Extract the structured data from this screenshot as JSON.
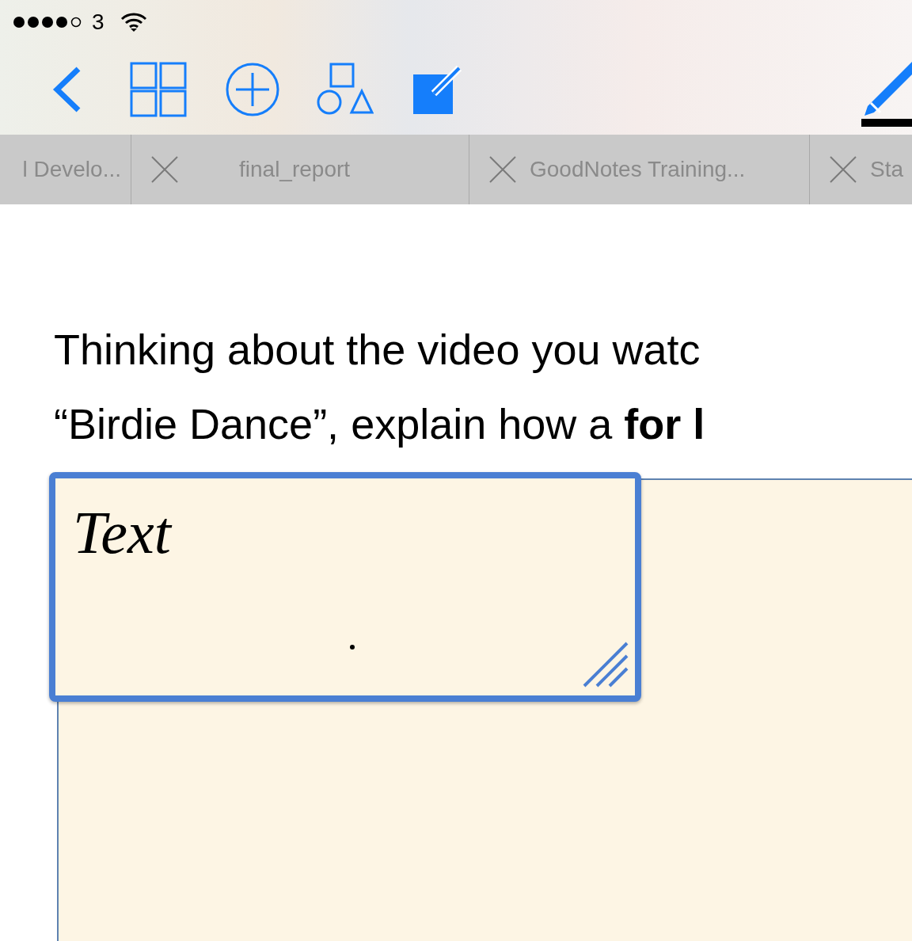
{
  "status_bar": {
    "carrier": "3"
  },
  "tabs": [
    {
      "label": "l Develo...",
      "closable": false,
      "selected": false
    },
    {
      "label": "final_report",
      "closable": true,
      "selected": false
    },
    {
      "label": "GoodNotes Training...",
      "closable": true,
      "selected": false
    },
    {
      "label": "Sta",
      "closable": true,
      "selected": false
    }
  ],
  "page": {
    "question_lines": [
      "Thinking about the video you watc",
      "“Birdie Dance”, explain how a **for l**"
    ],
    "text_box": {
      "handwriting": "Text",
      "selected": true
    }
  }
}
